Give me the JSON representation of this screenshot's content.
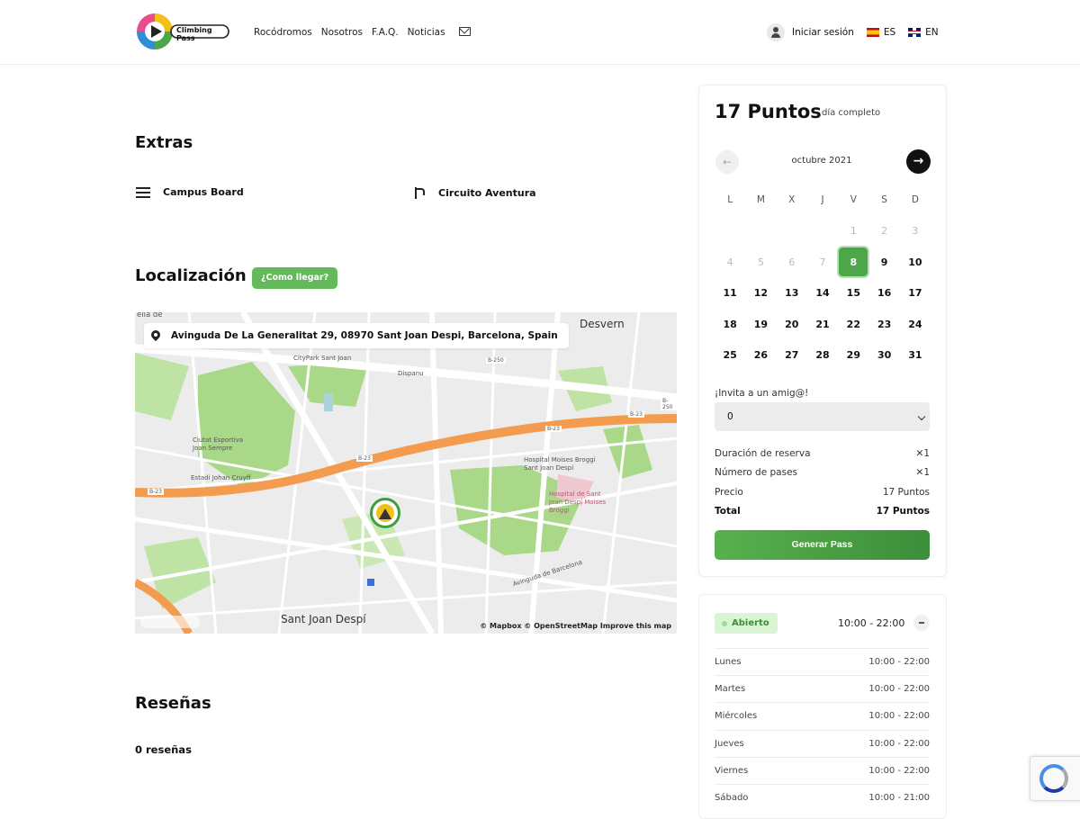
{
  "header": {
    "logo_text": "Climbing Pass",
    "nav": [
      "Rocódromos",
      "Nosotros",
      "F.A.Q.",
      "Noticias"
    ],
    "login": "Iniciar sesión",
    "lang_es": "ES",
    "lang_en": "EN"
  },
  "extras": {
    "title": "Extras",
    "items": [
      "Campus Board",
      "Circuito Aventura"
    ]
  },
  "location": {
    "title": "Localización",
    "how_to_get": "¿Como llegar?",
    "address": "Avinguda De La Generalitat 29, 08970 Sant Joan Despi, Barcelona, Spain",
    "map_labels": {
      "top_left": "elia de",
      "desvern": "Desvern",
      "citypark": "CityPark Sant Joan",
      "dispanu": "Dispanu",
      "ciutat": "Ciutat Esportiva Joan Sempre",
      "estadi": "Estadi Johan Cruyff",
      "hospital": "Hospital Moises Broggi Sant Joan Despí",
      "hospital2": "Hospital de Sant Joan Despí Moises Broggi",
      "avinguda": "Avinguda de Barcelona",
      "sant_joan": "Sant Joan Despí",
      "road1": "B-23",
      "road2": "B-23",
      "road3": "B-23",
      "road4": "B-23",
      "road5": "B-250",
      "road6": "B-250"
    },
    "attribution": "© Mapbox © OpenStreetMap Improve this map"
  },
  "reviews": {
    "title": "Reseñas",
    "count": "0 reseñas"
  },
  "booking": {
    "points": "17 Puntos",
    "points_sub": "día completo",
    "month": "octubre 2021",
    "weekdays": [
      "L",
      "M",
      "X",
      "J",
      "V",
      "S",
      "D"
    ],
    "days": [
      {
        "d": "",
        "s": "empty"
      },
      {
        "d": "",
        "s": "empty"
      },
      {
        "d": "",
        "s": "empty"
      },
      {
        "d": "",
        "s": "empty"
      },
      {
        "d": "1",
        "s": "dim"
      },
      {
        "d": "2",
        "s": "dim"
      },
      {
        "d": "3",
        "s": "dim"
      },
      {
        "d": "4",
        "s": "dim"
      },
      {
        "d": "5",
        "s": "dim"
      },
      {
        "d": "6",
        "s": "dim"
      },
      {
        "d": "7",
        "s": "dim"
      },
      {
        "d": "8",
        "s": "today"
      },
      {
        "d": "9",
        "s": "day"
      },
      {
        "d": "10",
        "s": "day"
      },
      {
        "d": "11",
        "s": "day"
      },
      {
        "d": "12",
        "s": "day"
      },
      {
        "d": "13",
        "s": "day"
      },
      {
        "d": "14",
        "s": "day"
      },
      {
        "d": "15",
        "s": "day"
      },
      {
        "d": "16",
        "s": "day"
      },
      {
        "d": "17",
        "s": "day"
      },
      {
        "d": "18",
        "s": "day"
      },
      {
        "d": "19",
        "s": "day"
      },
      {
        "d": "20",
        "s": "day"
      },
      {
        "d": "21",
        "s": "day"
      },
      {
        "d": "22",
        "s": "day"
      },
      {
        "d": "23",
        "s": "day"
      },
      {
        "d": "24",
        "s": "day"
      },
      {
        "d": "25",
        "s": "day"
      },
      {
        "d": "26",
        "s": "day"
      },
      {
        "d": "27",
        "s": "day"
      },
      {
        "d": "28",
        "s": "day"
      },
      {
        "d": "29",
        "s": "day"
      },
      {
        "d": "30",
        "s": "day"
      },
      {
        "d": "31",
        "s": "day"
      }
    ],
    "invite_label": "¡Invita a un amig@!",
    "invite_value": "0",
    "summary": [
      {
        "label": "Duración de reserva",
        "value": "✕1"
      },
      {
        "label": "Número de pases",
        "value": "✕1"
      },
      {
        "label": "Precio",
        "value": "17 Puntos"
      }
    ],
    "total_label": "Total",
    "total_value": "17 Puntos",
    "generate": "Generar Pass"
  },
  "hours": {
    "status": "Abierto",
    "now": "10:00 - 22:00",
    "days": [
      {
        "day": "Lunes",
        "time": "10:00 - 22:00"
      },
      {
        "day": "Martes",
        "time": "10:00 - 22:00"
      },
      {
        "day": "Miércoles",
        "time": "10:00 - 22:00"
      },
      {
        "day": "Jueves",
        "time": "10:00 - 22:00"
      },
      {
        "day": "Viernes",
        "time": "10:00 - 22:00"
      },
      {
        "day": "Sábado",
        "time": "10:00 - 21:00"
      }
    ]
  },
  "colors": {
    "brand_green": "#4ea64a",
    "highway_orange": "#f39b4f",
    "park_green": "#a9d889"
  }
}
